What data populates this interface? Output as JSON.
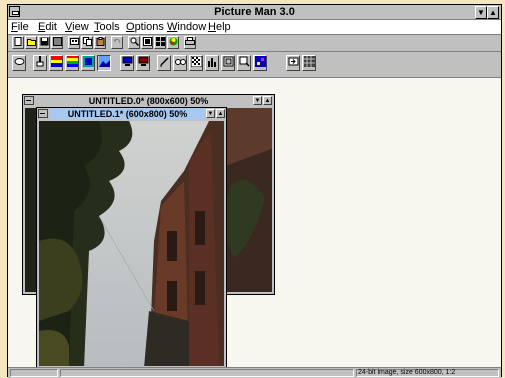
{
  "app": {
    "title": "Picture Man 3.0",
    "sys_btn_min": "▼",
    "sys_btn_max": "▲"
  },
  "menu": [
    {
      "label": "File",
      "ul": "F",
      "rest": "ile"
    },
    {
      "label": "Edit",
      "ul": "E",
      "rest": "dit"
    },
    {
      "label": "View",
      "ul": "V",
      "rest": "iew"
    },
    {
      "label": "Tools",
      "ul": "T",
      "rest": "ools"
    },
    {
      "label": "Options",
      "ul": "O",
      "rest": "ptions"
    },
    {
      "label": "Window",
      "ul": "W",
      "rest": "indow"
    },
    {
      "label": "Help",
      "ul": "H",
      "rest": "elp"
    }
  ],
  "toolbar1_icons": [
    "new-document-icon",
    "open-folder-icon",
    "save-icon",
    "save-as-icon",
    "cut-icon",
    "copy-icon",
    "paste-icon",
    "undo-icon",
    "zoom-icon",
    "fit-window-icon",
    "palette-icon",
    "color-picker-icon",
    "print-icon"
  ],
  "toolbar2_icons": [
    "lasso-icon",
    "brush-icon",
    "gradient-icon",
    "color-bars-icon",
    "image-icon",
    "landscape-icon",
    "monitor-icon",
    "scanner-icon",
    "pen-icon",
    "binoculars-icon",
    "dither-icon",
    "histogram-icon",
    "crop-icon",
    "magnify-icon",
    "filter-icon",
    "go-icon",
    "grid-icon"
  ],
  "windows": {
    "back": {
      "title": "UNTITLED.0* (800x600) 50%"
    },
    "front": {
      "title": "UNTITLED.1* (600x800) 50%"
    }
  },
  "status": {
    "text": "24-bit image, size 600x800, 1:2"
  },
  "colors": {
    "workspace": "#f7f7ef",
    "active_title": "#a8c8f0",
    "chrome": "#c0c0c0",
    "desktop": "#f5e6c0"
  }
}
